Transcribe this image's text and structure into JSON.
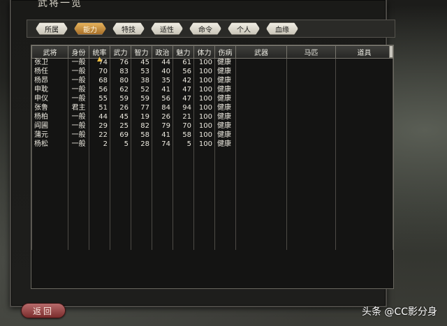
{
  "title": "武将一览",
  "tabs": [
    {
      "label": "所属",
      "active": false
    },
    {
      "label": "能力",
      "active": true
    },
    {
      "label": "特技",
      "active": false
    },
    {
      "label": "适性",
      "active": false
    },
    {
      "label": "命令",
      "active": false
    },
    {
      "label": "个人",
      "active": false
    },
    {
      "label": "血缘",
      "active": false
    }
  ],
  "columns": [
    "武将",
    "身份",
    "统率",
    "武力",
    "智力",
    "政治",
    "魅力",
    "体力",
    "伤病",
    "武器",
    "马匹",
    "道具"
  ],
  "rows": [
    [
      "张卫",
      "一般",
      "74",
      "76",
      "45",
      "44",
      "61",
      "100",
      "健康",
      "",
      "",
      ""
    ],
    [
      "杨任",
      "一般",
      "70",
      "83",
      "53",
      "40",
      "56",
      "100",
      "健康",
      "",
      "",
      ""
    ],
    [
      "杨昂",
      "一般",
      "68",
      "80",
      "38",
      "35",
      "42",
      "100",
      "健康",
      "",
      "",
      ""
    ],
    [
      "申耽",
      "一般",
      "56",
      "62",
      "52",
      "41",
      "47",
      "100",
      "健康",
      "",
      "",
      ""
    ],
    [
      "申仪",
      "一般",
      "55",
      "59",
      "59",
      "56",
      "47",
      "100",
      "健康",
      "",
      "",
      ""
    ],
    [
      "张鲁",
      "君主",
      "51",
      "26",
      "77",
      "84",
      "94",
      "100",
      "健康",
      "",
      "",
      ""
    ],
    [
      "杨柏",
      "一般",
      "44",
      "45",
      "19",
      "26",
      "21",
      "100",
      "健康",
      "",
      "",
      ""
    ],
    [
      "阎圃",
      "一般",
      "29",
      "25",
      "82",
      "79",
      "70",
      "100",
      "健康",
      "",
      "",
      ""
    ],
    [
      "蒲元",
      "一般",
      "22",
      "69",
      "58",
      "41",
      "58",
      "100",
      "健康",
      "",
      "",
      ""
    ],
    [
      "杨松",
      "一般",
      "2",
      "5",
      "28",
      "74",
      "5",
      "100",
      "健康",
      "",
      "",
      ""
    ]
  ],
  "back_button": "返回",
  "watermark": "头条 @CC影分身"
}
